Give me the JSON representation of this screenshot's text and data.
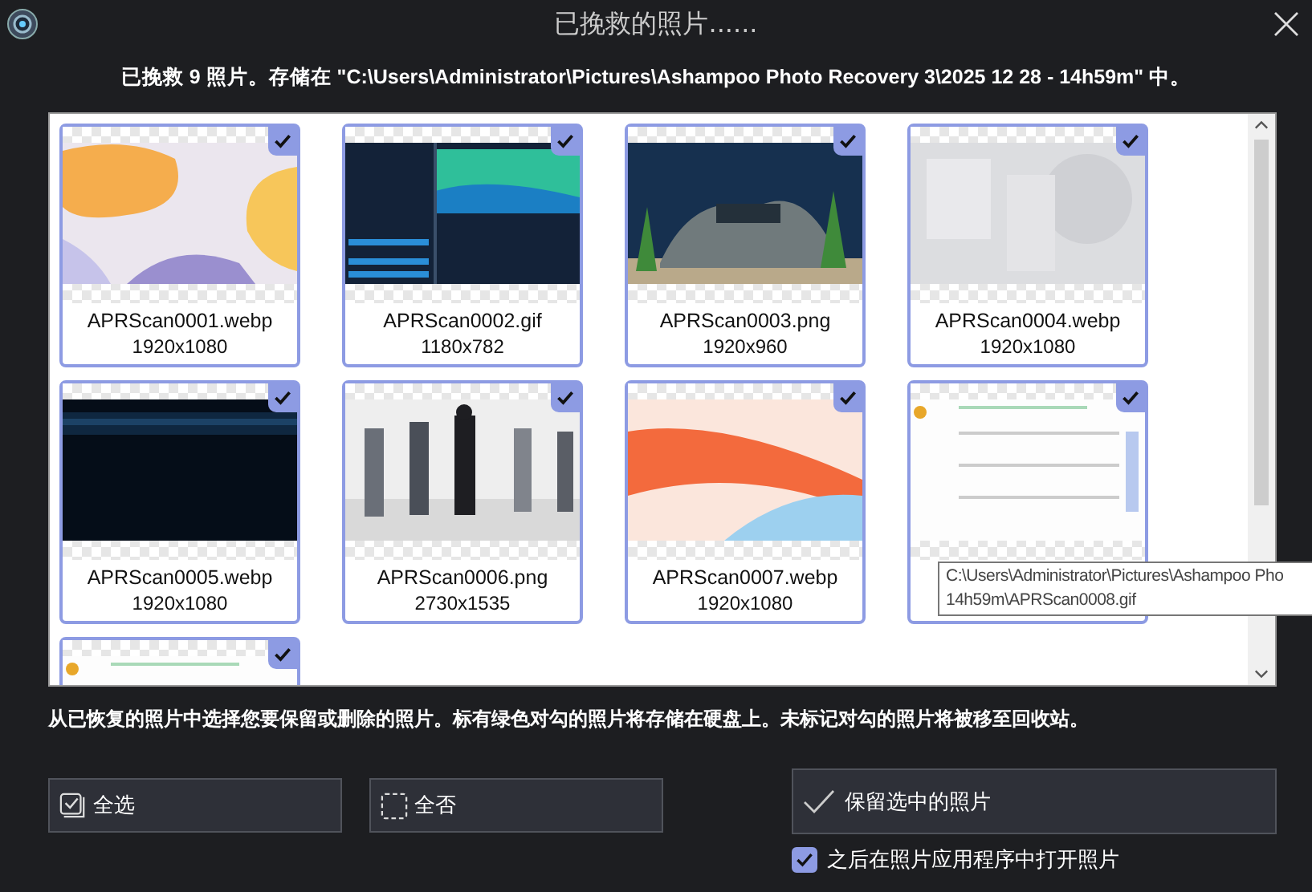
{
  "window": {
    "title": "已挽救的照片......"
  },
  "summary": "已挽救 9 照片。存储在 \"C:\\Users\\Administrator\\Pictures\\Ashampoo Photo Recovery 3\\2025 12 28 - 14h59m\" 中。",
  "photos": [
    {
      "name": "APRScan0001.webp",
      "size": "1920x1080",
      "checked": true
    },
    {
      "name": "APRScan0002.gif",
      "size": "1180x782",
      "checked": true
    },
    {
      "name": "APRScan0003.png",
      "size": "1920x960",
      "checked": true
    },
    {
      "name": "APRScan0004.webp",
      "size": "1920x1080",
      "checked": true
    },
    {
      "name": "APRScan0005.webp",
      "size": "1920x1080",
      "checked": true
    },
    {
      "name": "APRScan0006.png",
      "size": "2730x1535",
      "checked": true
    },
    {
      "name": "APRScan0007.webp",
      "size": "1920x1080",
      "checked": true
    },
    {
      "checked": true
    },
    {
      "checked": true
    }
  ],
  "tooltip": {
    "lines": [
      "C:\\Users\\Administrator\\Pictures\\Ashampoo Pho",
      "14h59m\\APRScan0008.gif"
    ]
  },
  "instructions": "从已恢复的照片中选择您要保留或删除的照片。标有绿色对勾的照片将存储在硬盘上。未标记对勾的照片将被移至回收站。",
  "buttons": {
    "select_all": "全选",
    "select_none": "全否",
    "keep": "保留选中的照片"
  },
  "open_after": {
    "label": "之后在照片应用程序中打开照片",
    "checked": true
  }
}
